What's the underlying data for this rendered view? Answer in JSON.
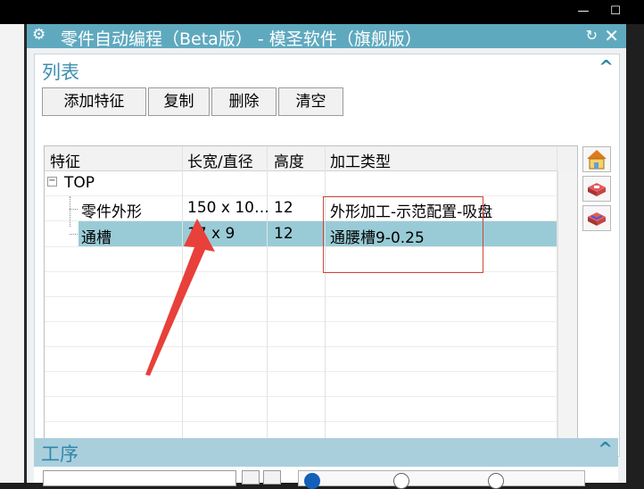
{
  "window": {
    "title": "零件自动编程（Beta版） - 模圣软件（旗舰版）"
  },
  "list_section": {
    "title": "列表",
    "buttons": [
      "添加特征",
      "复制",
      "删除",
      "清空"
    ],
    "columns": [
      "特征",
      "长宽/直径",
      "高度",
      "加工类型"
    ],
    "root": {
      "name": "TOP",
      "expander": "−"
    },
    "rows": [
      {
        "feature": "零件外形",
        "size": "150 x 10…",
        "height": "12",
        "type": "外形加工-示范配置-吸盘",
        "selected": false
      },
      {
        "feature": "通槽",
        "size": "17 x 9",
        "height": "12",
        "type": "通腰槽9-0.25",
        "selected": true
      }
    ]
  },
  "process_section": {
    "title": "工序",
    "radio_labels": [
      "",
      "",
      ""
    ]
  },
  "colors": {
    "titlebar": "#5fa9bf",
    "selected_row": "#99cbd6",
    "annotation": "#e8403a"
  }
}
